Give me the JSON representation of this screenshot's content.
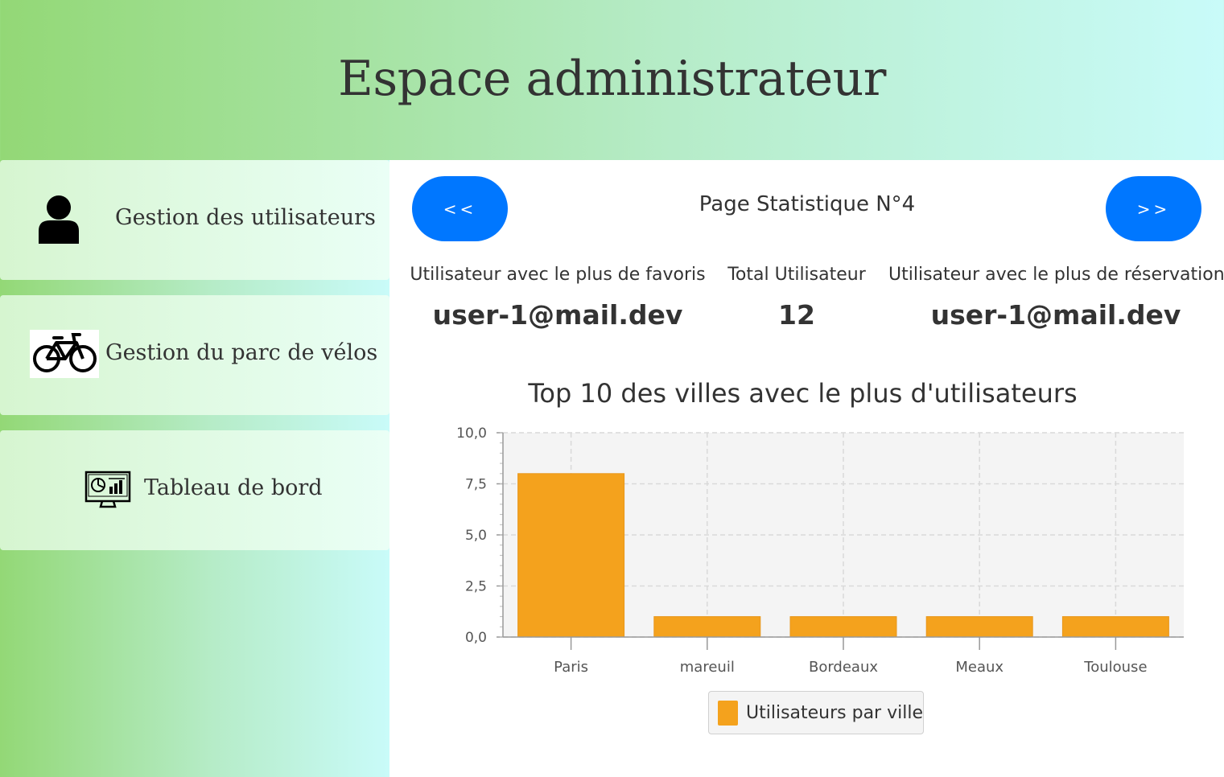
{
  "header": {
    "title": "Espace administrateur"
  },
  "sidebar": {
    "items": [
      {
        "label": "Gestion des utilisateurs",
        "icon": "user-icon"
      },
      {
        "label": "Gestion du parc de vélos",
        "icon": "bicycle-icon"
      },
      {
        "label": "Tableau de bord",
        "icon": "dashboard-monitor-icon"
      }
    ]
  },
  "main": {
    "prev_label": "<<",
    "next_label": ">>",
    "page_title": "Page Statistique N°4",
    "stats": [
      {
        "label": "Utilisateur avec le plus de favoris",
        "value": "user-1@mail.dev"
      },
      {
        "label": "Total Utilisateur",
        "value": "12"
      },
      {
        "label": "Utilisateur avec le plus de réservations",
        "value": "user-1@mail.dev"
      }
    ]
  },
  "colors": {
    "accent": "#0077ff",
    "bar": "#f4a21d"
  },
  "chart_data": {
    "type": "bar",
    "title": "Top 10 des villes avec le plus d'utilisateurs",
    "categories": [
      "Paris",
      "mareuil",
      "Bordeaux",
      "Meaux",
      "Toulouse"
    ],
    "series": [
      {
        "name": "Utilisateurs par ville",
        "values": [
          8,
          1,
          1,
          1,
          1
        ]
      }
    ],
    "ylim": [
      0,
      10
    ],
    "yticks": [
      "0,0",
      "2,5",
      "5,0",
      "7,5",
      "10,0"
    ],
    "ytick_values": [
      0,
      2.5,
      5,
      7.5,
      10
    ],
    "grid": true,
    "legend": "bottom"
  }
}
